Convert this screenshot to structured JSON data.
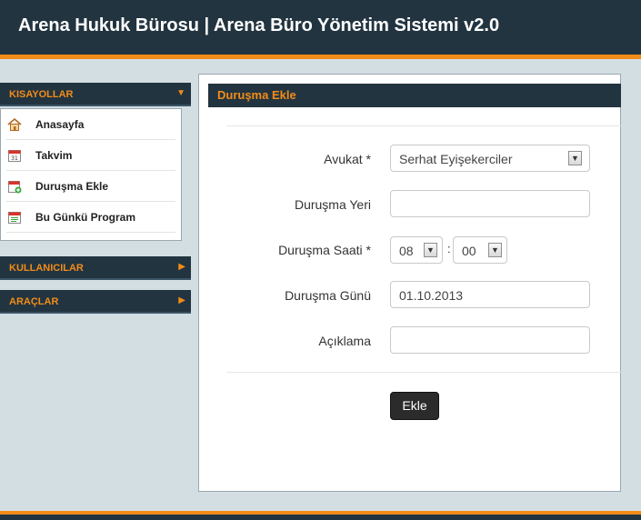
{
  "header": {
    "title": "Arena Hukuk Bürosu | Arena Büro Yönetim Sistemi v2.0"
  },
  "sidebar": {
    "sections": [
      {
        "label": "KISAYOLLAR",
        "expanded": true
      },
      {
        "label": "KULLANICILAR",
        "expanded": false
      },
      {
        "label": "ARAÇLAR",
        "expanded": false
      }
    ],
    "items": [
      {
        "label": "Anasayfa",
        "icon": "home-icon"
      },
      {
        "label": "Takvim",
        "icon": "calendar-icon"
      },
      {
        "label": "Duruşma Ekle",
        "icon": "calendar-add-icon"
      },
      {
        "label": "Bu Günkü Program",
        "icon": "calendar-list-icon"
      }
    ]
  },
  "panel": {
    "title": "Duruşma Ekle"
  },
  "form": {
    "avukat_label": "Avukat *",
    "avukat_value": "Serhat Eyişekerciler",
    "yer_label": "Duruşma Yeri",
    "yer_value": "",
    "saat_label": "Duruşma Saati *",
    "saat_hour": "08",
    "saat_minute": "00",
    "saat_separator": ":",
    "gun_label": "Duruşma Günü",
    "gun_value": "01.10.2013",
    "aciklama_label": "Açıklama",
    "aciklama_value": "",
    "submit_label": "Ekle"
  },
  "colors": {
    "navy": "#223440",
    "accent": "#f28c18",
    "background": "#d3dee3"
  }
}
